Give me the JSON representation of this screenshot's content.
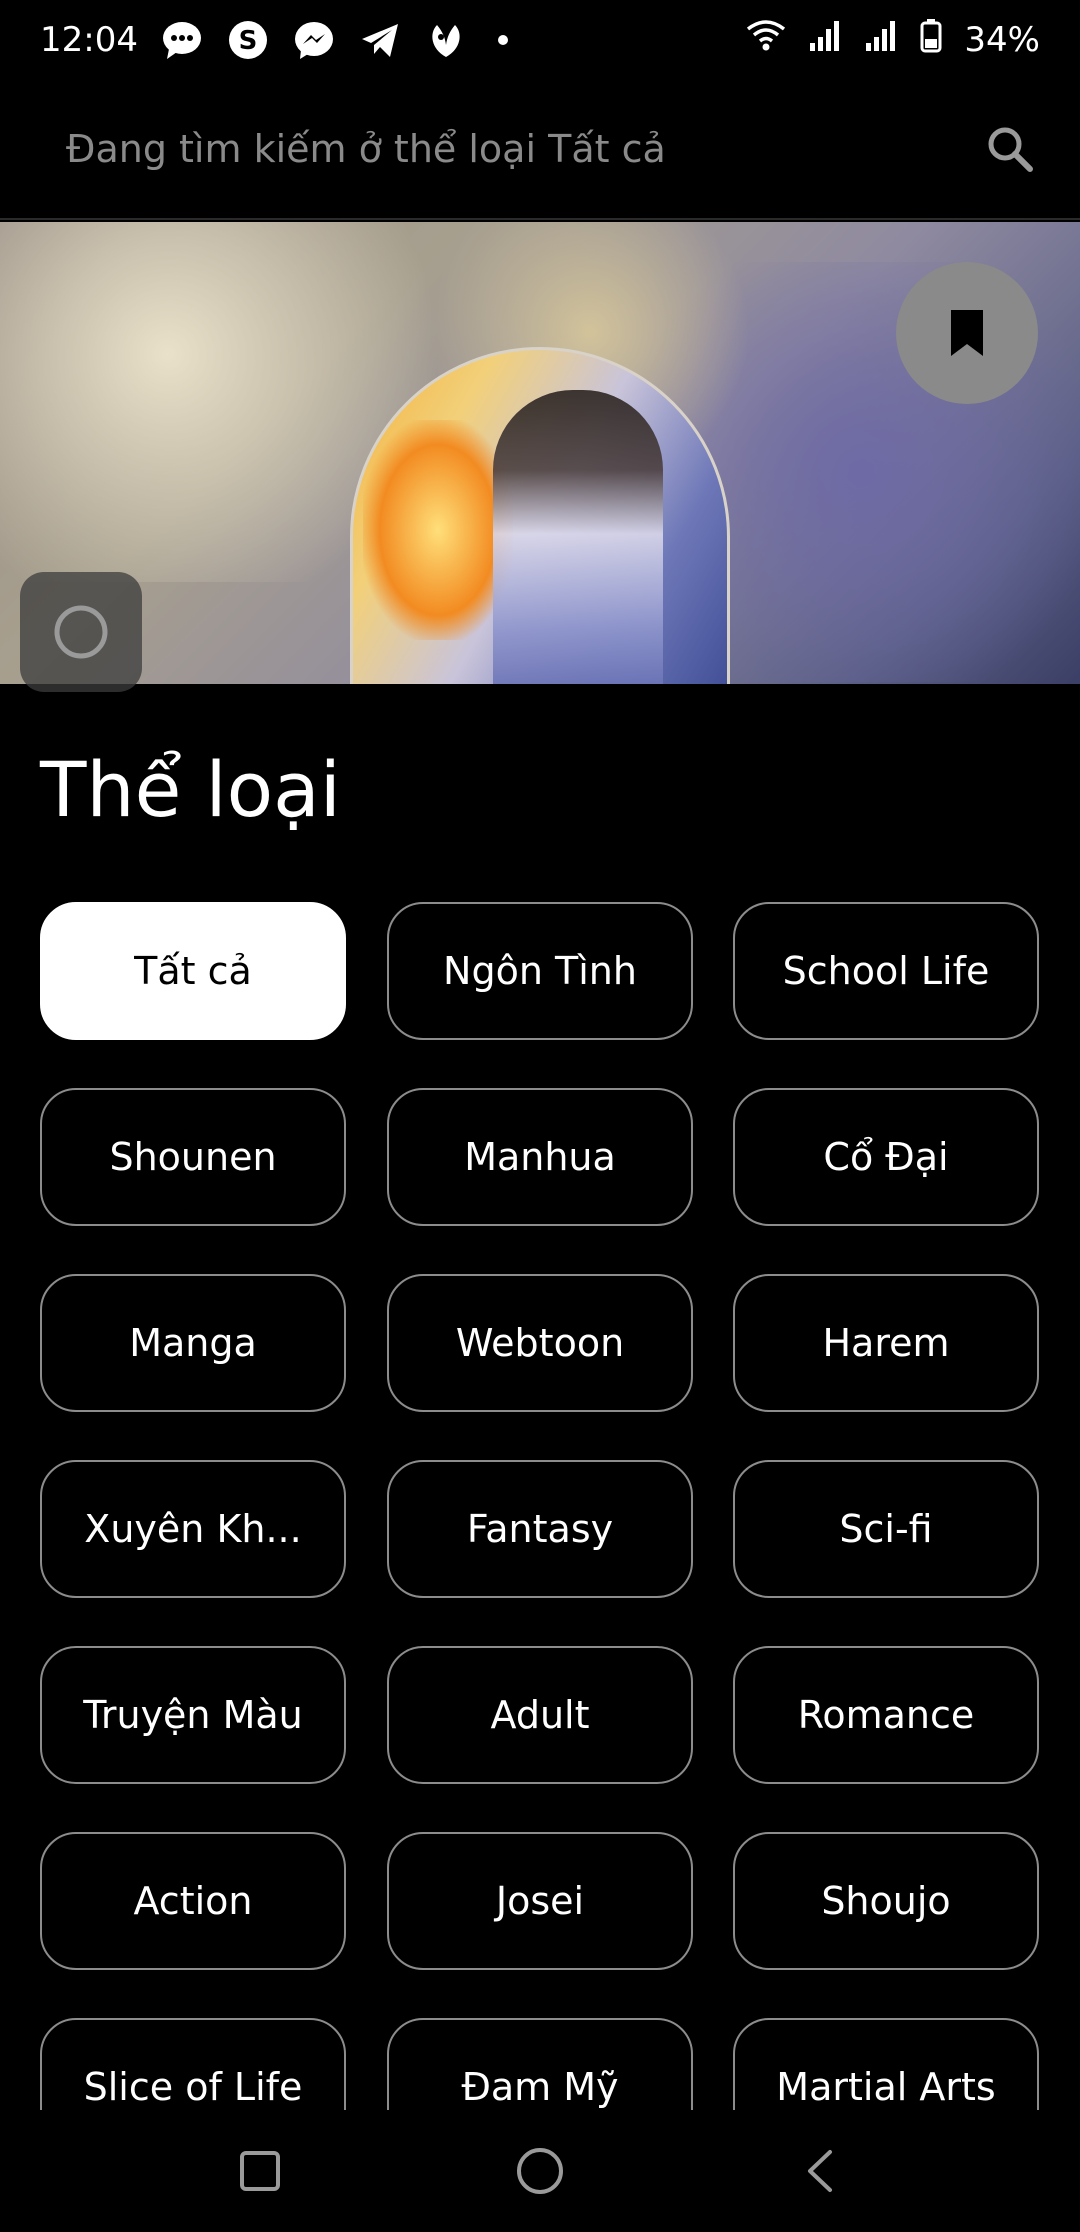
{
  "status_bar": {
    "time": "12:04",
    "battery": "34%",
    "notification_icons": [
      "chat-bubble-icon",
      "skype-icon",
      "messenger-icon",
      "telegram-icon",
      "leaf-icon"
    ]
  },
  "search": {
    "placeholder": "Đang tìm kiếm ở thể loại Tất cả",
    "value": ""
  },
  "section": {
    "title": "Thể loại"
  },
  "categories": [
    {
      "label": "Tất cả",
      "selected": true
    },
    {
      "label": "Ngôn Tình"
    },
    {
      "label": "School Life"
    },
    {
      "label": "Shounen"
    },
    {
      "label": "Manhua"
    },
    {
      "label": "Cổ Đại"
    },
    {
      "label": "Manga"
    },
    {
      "label": "Webtoon"
    },
    {
      "label": "Harem"
    },
    {
      "label": "Xuyên Kh..."
    },
    {
      "label": "Fantasy"
    },
    {
      "label": "Sci-fi"
    },
    {
      "label": "Truyện Màu"
    },
    {
      "label": "Adult"
    },
    {
      "label": "Romance"
    },
    {
      "label": "Action"
    },
    {
      "label": "Josei"
    },
    {
      "label": "Shoujo"
    },
    {
      "label": "Slice of Life"
    },
    {
      "label": "Đam Mỹ"
    },
    {
      "label": "Martial Arts"
    }
  ],
  "colors": {
    "background": "#000000",
    "chip_border": "#8c8c8c",
    "selected_chip_bg": "#ffffff",
    "bookmark_button": "#8a8a8a"
  }
}
